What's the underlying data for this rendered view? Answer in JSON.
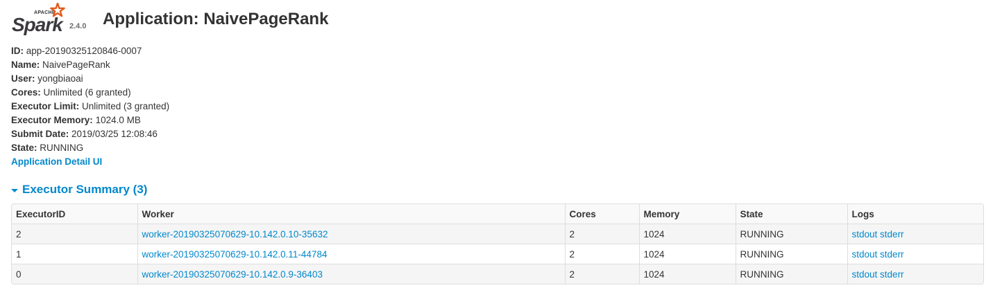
{
  "logo": {
    "apache": "APACHE",
    "spark": "Spark",
    "version": "2.4.0"
  },
  "title": "Application: NaivePageRank",
  "info": [
    {
      "label": "ID:",
      "value": "app-20190325120846-0007"
    },
    {
      "label": "Name:",
      "value": "NaivePageRank"
    },
    {
      "label": "User:",
      "value": "yongbiaoai"
    },
    {
      "label": "Cores:",
      "value": "Unlimited (6 granted)"
    },
    {
      "label": "Executor Limit:",
      "value": "Unlimited (3 granted)"
    },
    {
      "label": "Executor Memory:",
      "value": "1024.0 MB"
    },
    {
      "label": "Submit Date:",
      "value": "2019/03/25 12:08:46"
    },
    {
      "label": "State:",
      "value": "RUNNING"
    }
  ],
  "detail_link": "Application Detail UI",
  "executor_summary": {
    "title": "Executor Summary (3)",
    "columns": [
      "ExecutorID",
      "Worker",
      "Cores",
      "Memory",
      "State",
      "Logs"
    ],
    "rows": [
      {
        "id": "2",
        "worker": "worker-20190325070629-10.142.0.10-35632",
        "cores": "2",
        "memory": "1024",
        "state": "RUNNING",
        "stdout": "stdout",
        "stderr": "stderr"
      },
      {
        "id": "1",
        "worker": "worker-20190325070629-10.142.0.11-44784",
        "cores": "2",
        "memory": "1024",
        "state": "RUNNING",
        "stdout": "stdout",
        "stderr": "stderr"
      },
      {
        "id": "0",
        "worker": "worker-20190325070629-10.142.0.9-36403",
        "cores": "2",
        "memory": "1024",
        "state": "RUNNING",
        "stdout": "stdout",
        "stderr": "stderr"
      }
    ]
  },
  "colors": {
    "link": "#0088cc",
    "text": "#333333",
    "star": "#e25a1c",
    "border": "#dddddd"
  }
}
